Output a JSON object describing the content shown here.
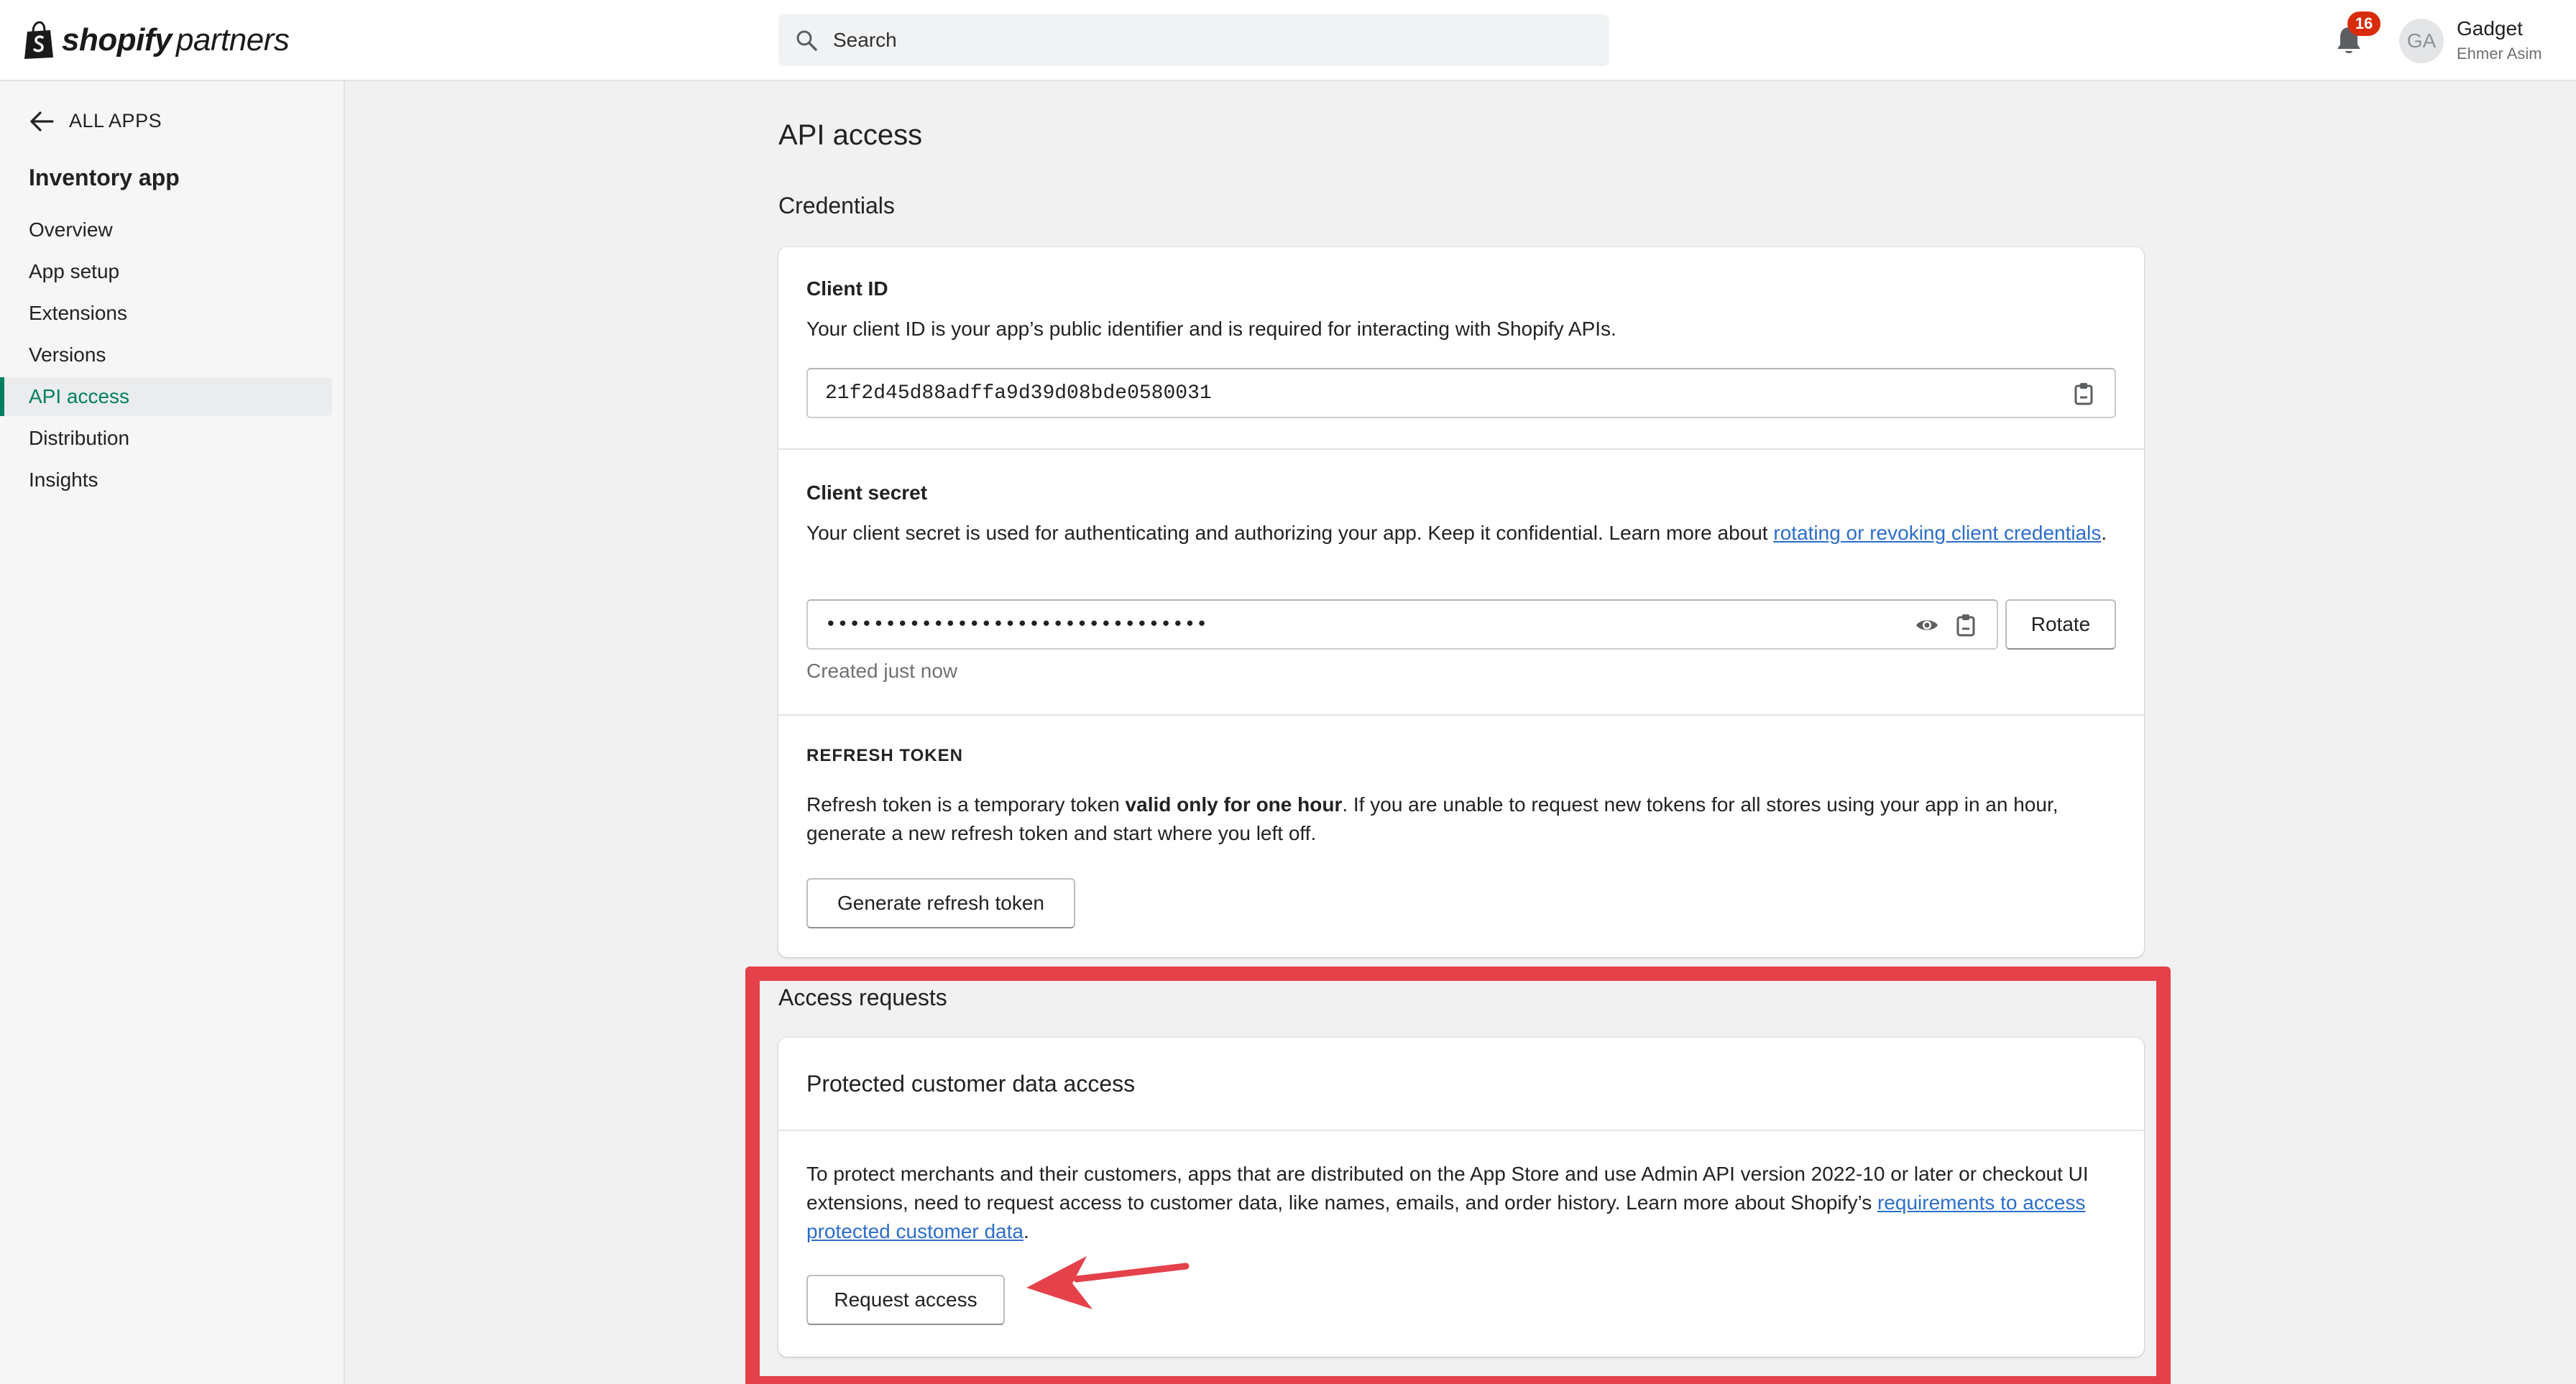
{
  "header": {
    "logo_brand": "shopify",
    "logo_sub": "partners",
    "search_placeholder": "Search",
    "notifications_count": "16",
    "user_initials": "GA",
    "user_name": "Gadget",
    "user_sub": "Ehmer Asim"
  },
  "sidebar": {
    "back_label": "ALL APPS",
    "app_name": "Inventory app",
    "items": [
      {
        "label": "Overview"
      },
      {
        "label": "App setup"
      },
      {
        "label": "Extensions"
      },
      {
        "label": "Versions"
      },
      {
        "label": "API access",
        "active": true
      },
      {
        "label": "Distribution"
      },
      {
        "label": "Insights"
      }
    ]
  },
  "main": {
    "page_title": "API access",
    "credentials": {
      "section_title": "Credentials",
      "client_id": {
        "label": "Client ID",
        "description": "Your client ID is your app’s public identifier and is required for interacting with Shopify APIs.",
        "value": "21f2d45d88adffa9d39d08bde0580031"
      },
      "client_secret": {
        "label": "Client secret",
        "description_before": "Your client secret is used for authenticating and authorizing your app. Keep it confidential. Learn more about ",
        "link": "rotating or revoking client credentials",
        "description_after": ".",
        "masked_value": "••••••••••••••••••••••••••••••••",
        "rotate_label": "Rotate",
        "created_note": "Created just now"
      },
      "refresh_token": {
        "label": "REFRESH TOKEN",
        "description_before": "Refresh token is a temporary token ",
        "bold": "valid only for one hour",
        "description_after": ". If you are unable to request new tokens for all stores using your app in an hour, generate a new refresh token and start where you left off.",
        "button_label": "Generate refresh token"
      }
    },
    "access_requests": {
      "section_title": "Access requests",
      "card_title": "Protected customer data access",
      "description_before": "To protect merchants and their customers, apps that are distributed on the App Store and use Admin API version 2022-10 or later or checkout UI extensions, need to request access to customer data, like names, emails, and order history. Learn more about Shopify’s ",
      "link": "requirements to access protected customer data",
      "description_after": ".",
      "button_label": "Request access"
    }
  },
  "colors": {
    "accent_green": "#007f5f",
    "link_blue": "#2c6ecb",
    "highlight_red": "#e4414b",
    "badge_red": "#d82c0d"
  }
}
